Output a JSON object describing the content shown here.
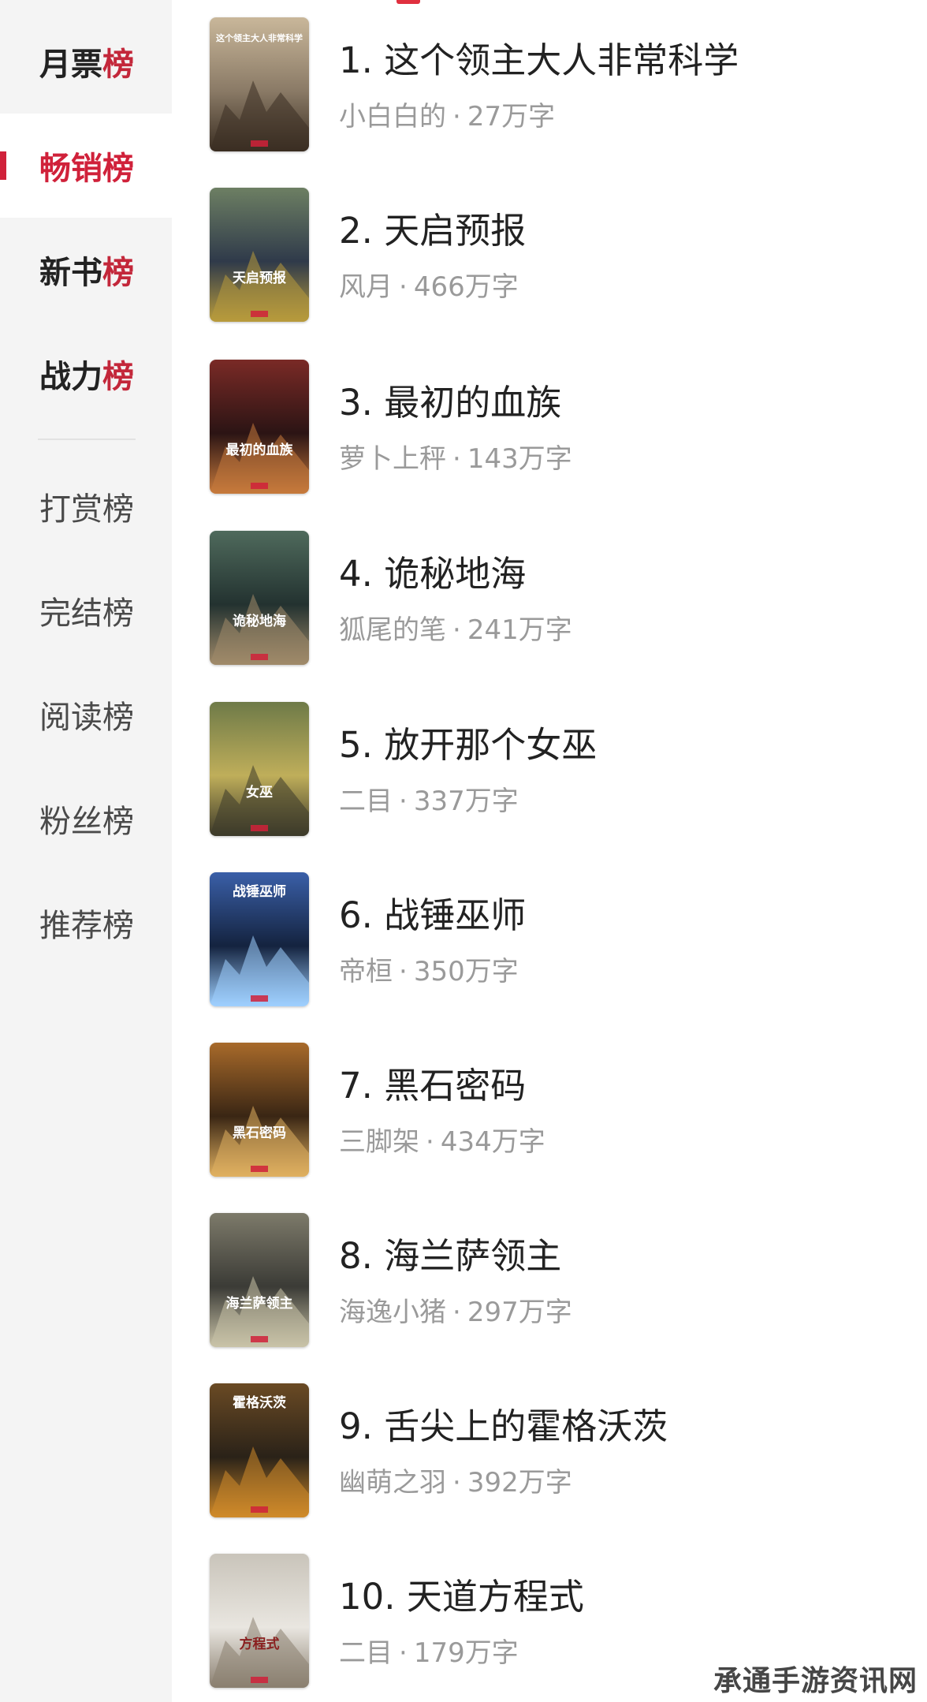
{
  "sidebar": {
    "items": [
      {
        "prefix": "月票",
        "suffix": "榜"
      },
      {
        "prefix": "畅销",
        "suffix": "榜"
      },
      {
        "prefix": "新书",
        "suffix": "榜"
      },
      {
        "prefix": "战力",
        "suffix": "榜"
      },
      {
        "label": "打赏榜"
      },
      {
        "label": "完结榜"
      },
      {
        "label": "阅读榜"
      },
      {
        "label": "粉丝榜"
      },
      {
        "label": "推荐榜"
      }
    ],
    "active_index": 1
  },
  "books": [
    {
      "title": "1. 这个领主大人非常科学",
      "author": "小白白的",
      "words": "27万字",
      "cover_text": "这个领主大人非常科学"
    },
    {
      "title": "2. 天启预报",
      "author": "风月",
      "words": "466万字",
      "cover_text": "天启预报"
    },
    {
      "title": "3. 最初的血族",
      "author": "萝卜上秤",
      "words": "143万字",
      "cover_text": "最初的血族"
    },
    {
      "title": "4. 诡秘地海",
      "author": "狐尾的笔",
      "words": "241万字",
      "cover_text": "诡秘地海"
    },
    {
      "title": "5. 放开那个女巫",
      "author": "二目",
      "words": "337万字",
      "cover_text": "女巫"
    },
    {
      "title": "6. 战锤巫师",
      "author": "帝桓",
      "words": "350万字",
      "cover_text": "战锤巫师"
    },
    {
      "title": "7. 黑石密码",
      "author": "三脚架",
      "words": "434万字",
      "cover_text": "黑石密码"
    },
    {
      "title": "8. 海兰萨领主",
      "author": "海逸小猪",
      "words": "297万字",
      "cover_text": "海兰萨领主"
    },
    {
      "title": "9. 舌尖上的霍格沃茨",
      "author": "幽萌之羽",
      "words": "392万字",
      "cover_text": "霍格沃茨"
    },
    {
      "title": "10. 天道方程式",
      "author": "二目",
      "words": "179万字",
      "cover_text": "方程式"
    }
  ],
  "separator": "·",
  "watermark": "承通手游资讯网",
  "colors": {
    "accent": "#d0213a",
    "sidebar_bg": "#f4f4f4",
    "meta_text": "#9a9a9a"
  }
}
